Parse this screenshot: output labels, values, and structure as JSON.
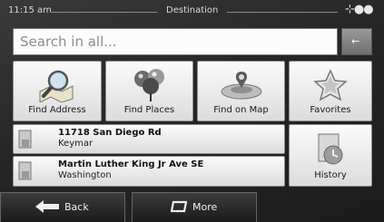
{
  "status": {
    "time": "11:15 am",
    "title": "Destination",
    "gps_icon": "satellite-icon"
  },
  "search": {
    "placeholder": "Search in all...",
    "backspace_icon": "arrow-left-icon",
    "backspace_glyph": "←"
  },
  "tiles": [
    {
      "label": "Find Address",
      "icon": "magnifier-map-icon"
    },
    {
      "label": "Find Places",
      "icon": "pins-icon"
    },
    {
      "label": "Find on Map",
      "icon": "map-pointer-icon"
    },
    {
      "label": "Favorites",
      "icon": "star-icon"
    }
  ],
  "recent": [
    {
      "line1": "11718 San Diego Rd",
      "line2": "Keymar",
      "icon": "recent-destination-icon"
    },
    {
      "line1": "Martin Luther King Jr Ave SE",
      "line2": "Washington",
      "icon": "recent-destination-icon"
    }
  ],
  "history": {
    "label": "History",
    "icon": "history-icon"
  },
  "bottom": {
    "back": "Back",
    "more": "More",
    "back_glyph": "🡄",
    "more_glyph": "▱"
  }
}
